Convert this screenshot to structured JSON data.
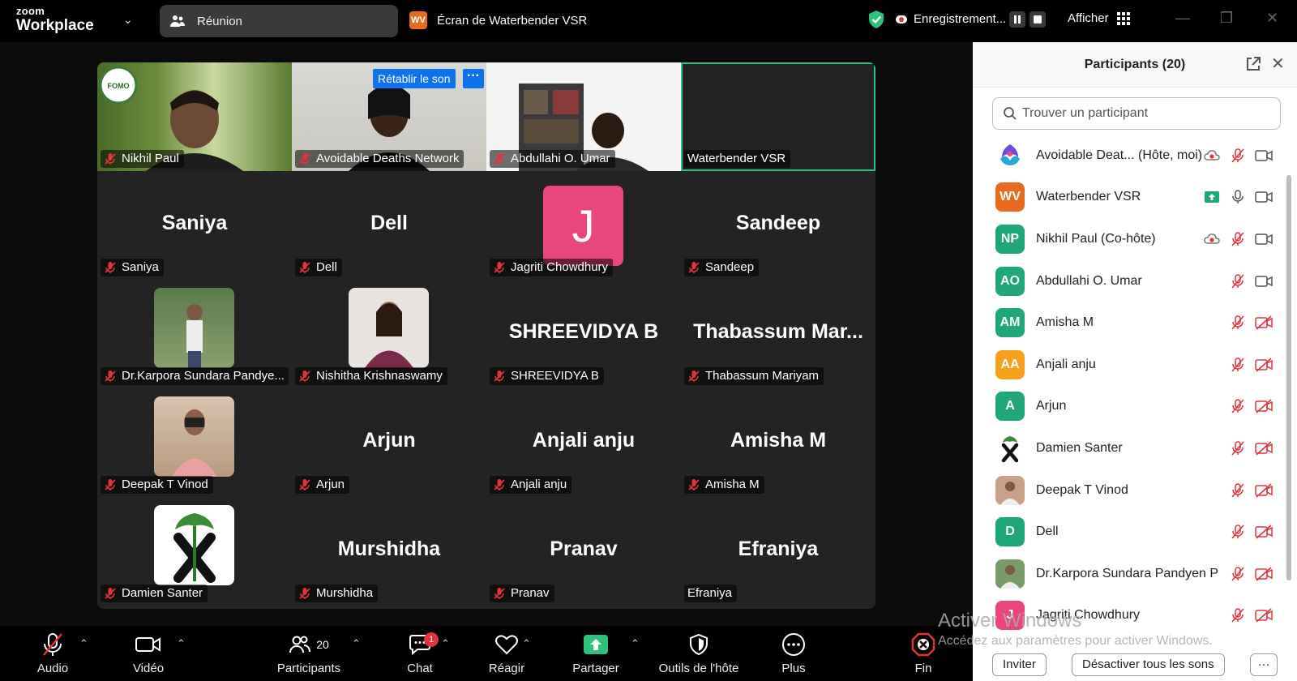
{
  "app": {
    "logo_top": "zoom",
    "logo_bottom": "Workplace",
    "meeting_tab": "Réunion",
    "share_tab_initials": "WV",
    "share_tab_label": "Écran de Waterbender VSR",
    "recording_label": "Enregistrement...",
    "view_label": "Afficher"
  },
  "grid": {
    "unmute_button": "Rétablir le son",
    "more_button": "···",
    "tiles": [
      {
        "name": "Nikhil Paul",
        "muted": true,
        "kind": "video"
      },
      {
        "name": "Avoidable Deaths Network",
        "muted": true,
        "kind": "video"
      },
      {
        "name": "Abdullahi O. Umar",
        "muted": true,
        "kind": "video"
      },
      {
        "name": "Waterbender VSR",
        "muted": false,
        "kind": "video",
        "active": true
      },
      {
        "name": "Saniya",
        "display": "Saniya",
        "muted": true,
        "kind": "text"
      },
      {
        "name": "Dell",
        "display": "Dell",
        "muted": true,
        "kind": "text"
      },
      {
        "name": "Jagriti Chowdhury",
        "avatar_letter": "J",
        "muted": true,
        "kind": "letter"
      },
      {
        "name": "Sandeep",
        "display": "Sandeep",
        "muted": true,
        "kind": "text"
      },
      {
        "name": "Dr.Karpora Sundara Pandye...",
        "muted": true,
        "kind": "photo"
      },
      {
        "name": "Nishitha Krishnaswamy",
        "muted": true,
        "kind": "photo"
      },
      {
        "name": "SHREEVIDYA B",
        "display": "SHREEVIDYA B",
        "muted": true,
        "kind": "text"
      },
      {
        "name": "Thabassum Mariyam",
        "display": "Thabassum  Mar...",
        "muted": true,
        "kind": "text"
      },
      {
        "name": "Deepak T Vinod",
        "muted": true,
        "kind": "photo"
      },
      {
        "name": "Arjun",
        "display": "Arjun",
        "muted": true,
        "kind": "text"
      },
      {
        "name": "Anjali anju",
        "display": "Anjali anju",
        "muted": true,
        "kind": "text"
      },
      {
        "name": "Amisha M",
        "display": "Amisha M",
        "muted": true,
        "kind": "text"
      },
      {
        "name": "Damien Santer",
        "muted": true,
        "kind": "photo"
      },
      {
        "name": "Murshidha",
        "display": "Murshidha",
        "muted": true,
        "kind": "text"
      },
      {
        "name": "Pranav",
        "display": "Pranav",
        "muted": true,
        "kind": "text"
      },
      {
        "name": "Efraniya",
        "display": "Efraniya",
        "muted": false,
        "kind": "text"
      }
    ]
  },
  "toolbar": {
    "audio": "Audio",
    "video": "Vidéo",
    "participants": "Participants",
    "participants_count": "20",
    "chat": "Chat",
    "chat_badge": "1",
    "react": "Réagir",
    "share": "Partager",
    "host_tools": "Outils de l'hôte",
    "more": "Plus",
    "end": "Fin"
  },
  "panel": {
    "title": "Participants (20)",
    "search_placeholder": "Trouver un participant",
    "invite": "Inviter",
    "mute_all": "Désactiver tous les sons",
    "more": "···",
    "participants": [
      {
        "name": "Avoidable Deat... (Hôte, moi)",
        "initials": "",
        "color": "#ffffff",
        "avatar": "logo",
        "cloud": true,
        "mic": "muted",
        "cam": "on"
      },
      {
        "name": "Waterbender VSR",
        "initials": "WV",
        "color": "#e86a1e",
        "avatar": "initials",
        "share": true,
        "mic": "on",
        "cam": "on"
      },
      {
        "name": "Nikhil Paul (Co-hôte)",
        "initials": "NP",
        "color": "#1fa67a",
        "avatar": "initials",
        "cloud": true,
        "mic": "muted",
        "cam": "on"
      },
      {
        "name": "Abdullahi O. Umar",
        "initials": "AO",
        "color": "#1fa67a",
        "avatar": "initials",
        "mic": "muted",
        "cam": "on"
      },
      {
        "name": "Amisha M",
        "initials": "AM",
        "color": "#1fa67a",
        "avatar": "initials",
        "mic": "muted",
        "cam": "off"
      },
      {
        "name": "Anjali anju",
        "initials": "AA",
        "color": "#f5a11c",
        "avatar": "initials",
        "mic": "muted",
        "cam": "off"
      },
      {
        "name": "Arjun",
        "initials": "A",
        "color": "#1fa67a",
        "avatar": "initials",
        "mic": "muted",
        "cam": "off"
      },
      {
        "name": "Damien Santer",
        "initials": "",
        "color": "#ffffff",
        "avatar": "x",
        "mic": "muted",
        "cam": "off"
      },
      {
        "name": "Deepak T Vinod",
        "initials": "",
        "color": "#c9a08a",
        "avatar": "photo",
        "mic": "muted",
        "cam": "off"
      },
      {
        "name": "Dell",
        "initials": "D",
        "color": "#1fa67a",
        "avatar": "initials",
        "mic": "muted",
        "cam": "off"
      },
      {
        "name": "Dr.Karpora Sundara Pandyen P",
        "initials": "",
        "color": "#7a9a6a",
        "avatar": "photo",
        "mic": "muted",
        "cam": "off"
      },
      {
        "name": "Jagriti Chowdhury",
        "initials": "J",
        "color": "#e8467c",
        "avatar": "initials",
        "mic": "muted",
        "cam": "off"
      }
    ]
  },
  "watermark": {
    "line1": "Activer Windows",
    "line2": "Accédez aux paramètres pour activer Windows."
  }
}
